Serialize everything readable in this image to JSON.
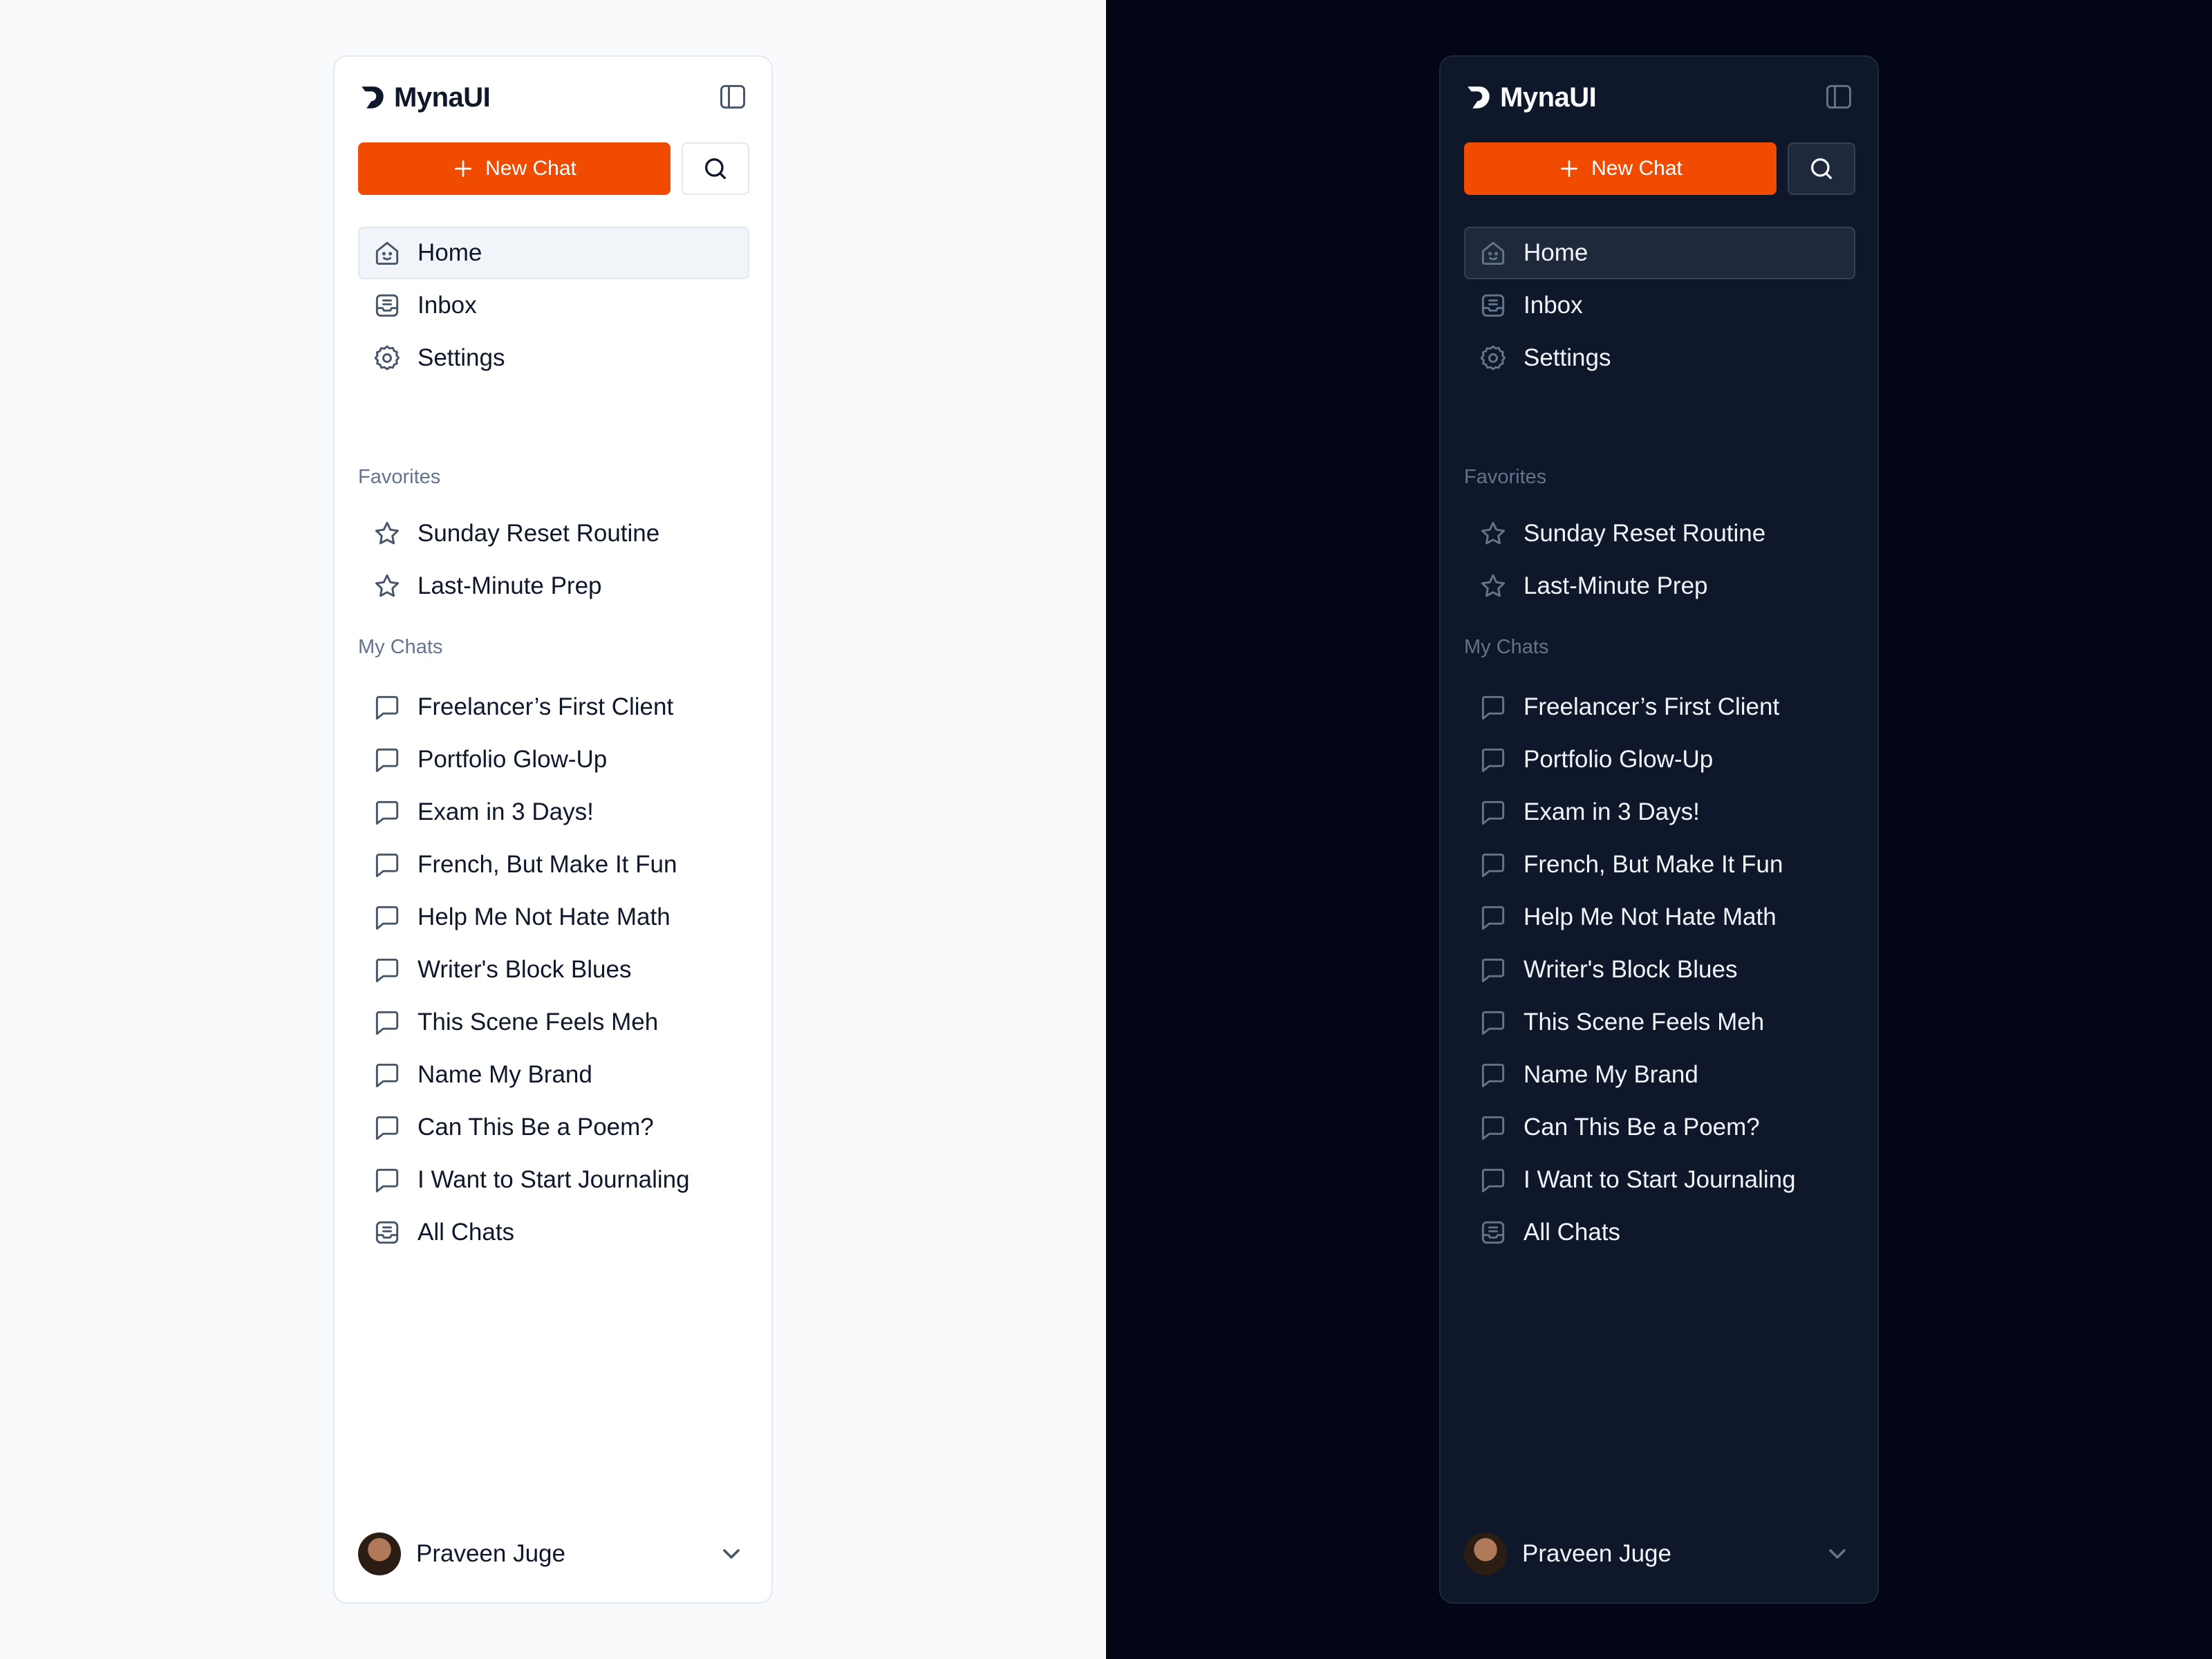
{
  "app": {
    "name": "MynaUI"
  },
  "themes": [
    {
      "key": "light",
      "icon_color": "#475569",
      "icon_color_dark": "#0f172a",
      "accent": "#f04b00"
    },
    {
      "key": "dark",
      "icon_color": "#64748b",
      "icon_color_dark": "#f8fafc",
      "accent": "#f04b00"
    }
  ],
  "actions": {
    "new_chat_label": "New Chat"
  },
  "nav": [
    {
      "label": "Home",
      "icon": "home-icon",
      "active": true
    },
    {
      "label": "Inbox",
      "icon": "inbox-icon"
    },
    {
      "label": "Settings",
      "icon": "gear-icon"
    }
  ],
  "favorites": {
    "title": "Favorites",
    "items": [
      {
        "label": "Sunday Reset Routine",
        "icon": "star-icon"
      },
      {
        "label": "Last-Minute Prep",
        "icon": "star-icon"
      }
    ]
  },
  "chats": {
    "title": "My Chats",
    "items": [
      {
        "label": "Freelancer’s First Client",
        "icon": "message-icon"
      },
      {
        "label": "Portfolio Glow-Up",
        "icon": "message-icon"
      },
      {
        "label": "Exam in 3 Days!",
        "icon": "message-icon"
      },
      {
        "label": "French, But Make It Fun",
        "icon": "message-icon"
      },
      {
        "label": "Help Me Not Hate Math",
        "icon": "message-icon"
      },
      {
        "label": "Writer's Block Blues",
        "icon": "message-icon"
      },
      {
        "label": "This Scene Feels Meh",
        "icon": "message-icon"
      },
      {
        "label": "Name My Brand",
        "icon": "message-icon"
      },
      {
        "label": "Can This Be a Poem?",
        "icon": "message-icon"
      },
      {
        "label": "I Want to Start Journaling",
        "icon": "message-icon"
      },
      {
        "label": "All Chats",
        "icon": "inbox-icon"
      }
    ]
  },
  "user": {
    "name": "Praveen Juge"
  }
}
